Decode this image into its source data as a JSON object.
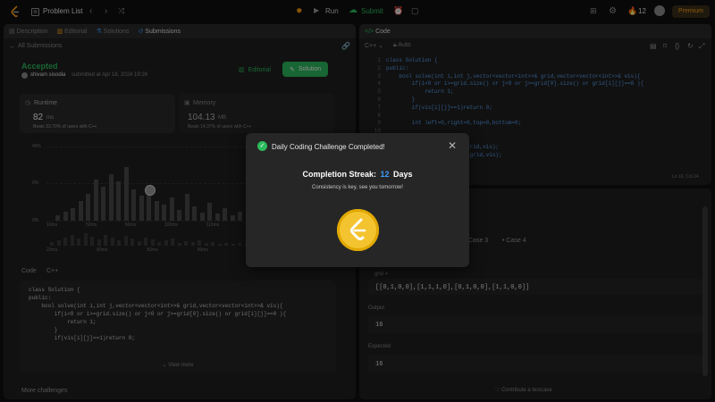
{
  "topbar": {
    "problem_list": "Problem List",
    "run": "Run",
    "submit": "Submit",
    "streak_count": "12",
    "premium": "Premium"
  },
  "left": {
    "tabs": [
      "Description",
      "Editorial",
      "Solutions",
      "Submissions"
    ],
    "back_label": "All Submissions",
    "status": "Accepted",
    "user": "shivam sisodia",
    "submitted_text": "submitted at Apr 18, 2024 19:26",
    "editorial_btn": "Editorial",
    "solution_btn": "Solution",
    "runtime_label": "Runtime",
    "runtime_value": "82",
    "runtime_unit": "ms",
    "runtime_beats": "Beats 33.70% of users with C++",
    "memory_label": "Memory",
    "memory_value": "104.13",
    "memory_unit": "MB",
    "memory_beats": "Beats 14.37% of users with C++",
    "y_ticks": [
      "40%",
      "0%",
      "0%"
    ],
    "x_ticks": [
      "10ms",
      "52ms",
      "60ms",
      "102ms",
      "113ms",
      "145ms"
    ],
    "x_ticks2": [
      "22ms",
      "60ms",
      "82ms",
      "90ms",
      "154ms"
    ],
    "code_label": "Code",
    "code_lang": "C++",
    "code_lines": [
      "class Solution {",
      "public:",
      "    bool solve(int i,int j,vector<vector<int>>& grid,vector<vector<int>>& vis){",
      "        if(i<0 or i>=grid.size() or j<0 or j>=grid[0].size() or grid[i][j]==0 ){",
      "            return 1;",
      "        }",
      "        if(vis[i][j]==1)return 0;"
    ],
    "view_more": "View more",
    "more_challenges": "More challenges"
  },
  "editor": {
    "header": "Code",
    "lang": "C++",
    "auto": "Auto",
    "line_numbers": [
      "1",
      "2",
      "3",
      "4",
      "5",
      "6",
      "7",
      "8",
      "9",
      "10",
      "11",
      "12",
      "13"
    ],
    "lines": [
      "class Solution {",
      "public:",
      "    bool solve(int i,int j,vector<vector<int>>& grid,vector<vector<int>>& vis){",
      "        if(i<0 or i>=grid.size() or j<0 or j>=grid[0].size() or grid[i][j]==0 ){",
      "            return 1;",
      "        }",
      "        if(vis[i][j]==1)return 0;",
      "",
      "        int left=0,right=0,top=0,bottom=0;",
      "",
      "        vis[i][j]=1;",
      "        left=solve(i,j-1,grid,vis);",
      "        right=solve(i,j+1,grid,vis);"
    ],
    "position": "Ln 16, Col 24"
  },
  "testcase": {
    "cases": [
      "Case 3",
      "Case 4"
    ],
    "grid_label": "grid =",
    "grid_value": "[[0,1,0,0],[1,1,1,0],[0,1,0,0],[1,1,0,0]]",
    "output_label": "Output",
    "output_value": "16",
    "expected_label": "Expected",
    "expected_value": "16",
    "contribute": "Contribute a testcase"
  },
  "modal": {
    "title": "Daily Coding Challenge Completed!",
    "streak_label": "Completion Streak:",
    "streak_number": "12",
    "streak_unit": "Days",
    "subtitle": "Consistency is key, see you tomorrow!"
  },
  "colors": {
    "accent_green": "#2cbb5d",
    "accent_orange": "#ffa116",
    "link_blue": "#3c9aff"
  }
}
